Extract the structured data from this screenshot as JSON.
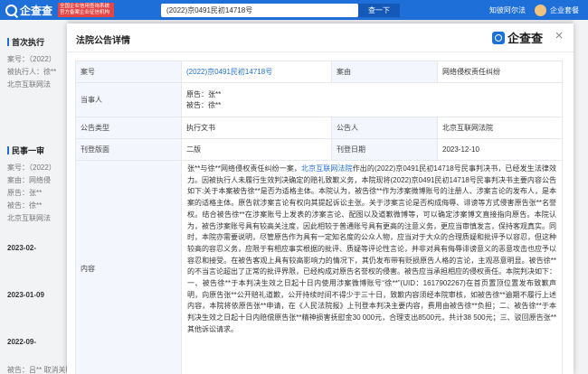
{
  "topbar": {
    "logo": "企查查",
    "badge": "全国企业信用查询系统 官方备案企业征信机构",
    "search_value": "(2022)京0491民初14718号",
    "search_button": "查一下",
    "product": "知彼阿尔法",
    "vip": "企业套餐"
  },
  "background": {
    "section1": "首次执行",
    "s1_case": "案号：（2022）",
    "s1_party": "被执行人：徐**",
    "s1_court": "北京互联网法",
    "section2": "民事一审",
    "s2_case": "案号：（2022）",
    "s2_cause": "案由：网络侵",
    "s2_plaintiff": "原告：张**",
    "s2_defendant": "被告：徐**",
    "s2_court": "北京互联网法",
    "s2_date1": "2023-02-",
    "s2_date2": "2023-01-09",
    "s2_date3": "2022-09-",
    "s2_footer": "被告：吕** 取消关联"
  },
  "modal": {
    "title": "法院公告详情",
    "brand": "企查查",
    "close": "×",
    "rows": {
      "case_no_label": "案号",
      "case_no": "(2022)京0491民初14718号",
      "cause_label": "案由",
      "cause": "网络侵权责任纠纷",
      "party_label": "当事人",
      "plaintiff": "原告：张**",
      "defendant": "被告：徐**",
      "type_label": "公告类型",
      "type": "执行文书",
      "publisher_label": "公告人",
      "publisher": "北京互联网法院",
      "page_label": "刊登版面",
      "page": "二版",
      "date_label": "刊登日期",
      "date": "2023-12-10",
      "content_label": "内容"
    },
    "content_prefix": "张**与徐**网络侵权责任纠纷一案，",
    "content_court": "北京互联网法院",
    "content_body": "作出的(2022)京0491民初14718号民事判决书，已经发生法律效力。因被执行人未履行生效判决确定的赔礼致歉义务，本院现将(2022)京0491民初14718号民事判决书主要内容公告如下:关于本案被告徐**是否为适格主体。本院认为，被告徐**作为涉案微博账号的注册人、涉案言论的发布人，是本案的适格主体。原告就涉案言论有权向其提起诉讼主张。关于涉案言论是否构成侮辱、诽谤等方式侵害原告张**名誉权。结合被告徐**在涉案账号上发表的涉案言论、配图以及道歉微博等，可以确定涉案博文直接指向原告。本院认为，被告涉案账号具有较高关注度，因此相较于普通账号具有更高的注意义务，更应当审慎发言，保持客观真实。同时，本院亦需要说明，尽管原告作为具有一定知名度的公众人物，应当对于大众的合理质疑和批评予以容忍，但这种较高的容忍义务，应限于有相应事实根据的批评、质疑等评论性言论，并非对具有侮辱诽谤意义的恶意攻击也应予以容忍和接受。在被告客观上具有较高影响力的情况下，其仍发布带有贬损原告人格的言论，主观恶意明显。被告徐**的不当言论超出了正常的批评界限，已经构成对原告名誉权的侵害。被告应当承担相应的侵权责任。本院判决如下：一、被告徐**于本判决生效之日起十日内使用涉案微博账号“徐**”(UID：1617902267)在首页置顶位置发布致歉声明，向原告张**公开赔礼道歉，公开持续时间不得少于三十日，致歉内容须经本院审核，如被告徐**逾期不履行上述内容，本院将依原告张**申请，在《人民法院报》上刊登本判决主要内容，费用由被告徐**负担；二、被告徐**于本判决生效之日起十日内赔偿原告张**精神损害抚慰金30 000元，合理支出8500元，共计38 500元；三、驳回原告张**其他诉讼请求。"
  }
}
